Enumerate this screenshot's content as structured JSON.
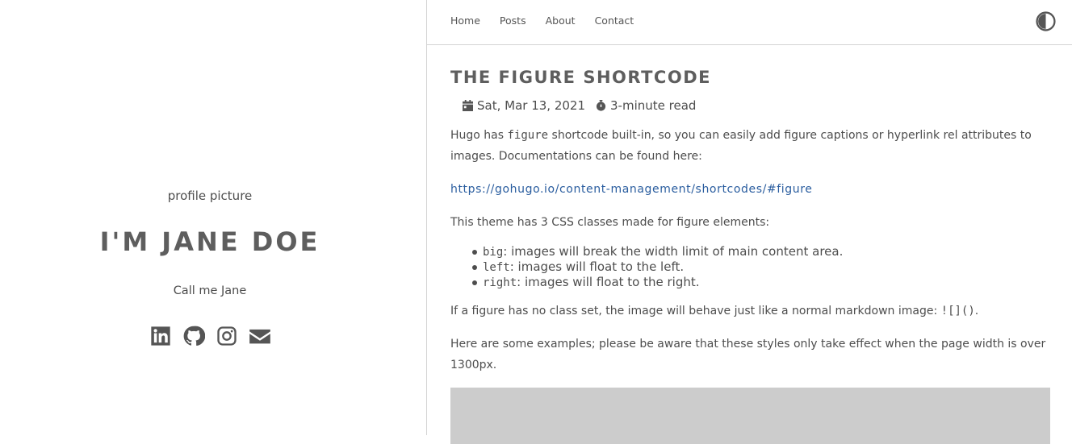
{
  "sidebar": {
    "profile_picture_alt": "profile picture",
    "title": "I'M JANE DOE",
    "tagline": "Call me Jane",
    "social_icons": [
      "linkedin-icon",
      "github-icon",
      "instagram-icon",
      "envelope-icon"
    ]
  },
  "nav": {
    "items": [
      {
        "label": "Home"
      },
      {
        "label": "Posts"
      },
      {
        "label": "About"
      },
      {
        "label": "Contact"
      }
    ],
    "theme_toggle_icon": "half-circle-icon"
  },
  "post": {
    "title": "THE FIGURE SHORTCODE",
    "date": "Sat, Mar 13, 2021",
    "read_time": "3-minute read",
    "intro_pre": "Hugo has ",
    "intro_code": "figure",
    "intro_post": " shortcode built-in, so you can easily add figure captions or hyperlink rel attributes to images. Documentations can be found here:",
    "link": "https://gohugo.io/content-management/shortcodes/#figure",
    "classes_intro": "This theme has 3 CSS classes made for figure elements:",
    "classes": [
      {
        "code": "big",
        "text": ": images will break the width limit of main content area."
      },
      {
        "code": "left",
        "text": ": images will float to the left."
      },
      {
        "code": "right",
        "text": ": images will float to the right."
      }
    ],
    "noclass_pre": "If a figure has no class set, the image will behave just like a normal markdown image: ",
    "noclass_code": "![]()",
    "noclass_post": ".",
    "examples": "Here are some examples; please be aware that these styles only take effect when the page width is over 1300px."
  },
  "colors": {
    "accent_link": "#2a5d9f",
    "placeholder": "#cccccc"
  }
}
